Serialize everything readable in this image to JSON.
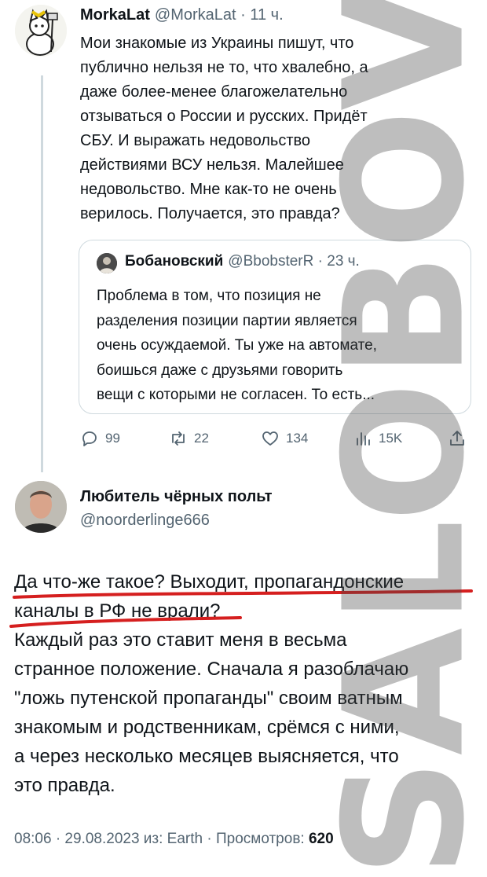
{
  "tweet1": {
    "name": "MorkaLat",
    "handle": "@MorkaLat",
    "time": "· 11 ч.",
    "lines": [
      "Мои знакомые из Украины пишут, что",
      "публично нельзя не то, что хвалебно, а",
      "даже более-менее благожелательно",
      "отзываться о России и русских. Придёт",
      "СБУ. И выражать недовольство",
      "действиями ВСУ нельзя. Малейшее",
      "недовольство. Мне как-то не очень",
      "верилось. Получается, это правда?"
    ]
  },
  "quote": {
    "name": "Бобановский",
    "handle": "@BbobsterR",
    "time": "· 23 ч.",
    "lines": [
      "Проблема в том, что позиция не",
      "разделения позиции партии является",
      "очень осуждаемой. Ты уже на автомате,",
      "боишься даже с друзьями говорить",
      "вещи с которыми не согласен. То есть..."
    ]
  },
  "actions": {
    "replies": "99",
    "retweets": "22",
    "likes": "134",
    "views": "15K"
  },
  "tweet2": {
    "name": "Любитель чёрных польт",
    "handle": "@noorderlinge666",
    "lines": [
      "Да что-же такое? Выходит, пропагандонские",
      "каналы в РФ не врали?",
      "Каждый раз это ставит меня в весьма",
      "странное положение. Сначала я разоблачаю",
      "\"ложь путенской пропаганды\" своим ватным",
      "знакомым и родственникам, срёмся с ними,",
      "а через несколько месяцев выясняется, что",
      "это правда."
    ],
    "footer": "08:06 · 29.08.2023 из: Earth · Просмотров:",
    "footer_views": "620"
  },
  "watermark": "SALOBOV",
  "colors": {
    "underline": "#d51f1f",
    "muted": "#536471",
    "text": "#0f1419"
  }
}
